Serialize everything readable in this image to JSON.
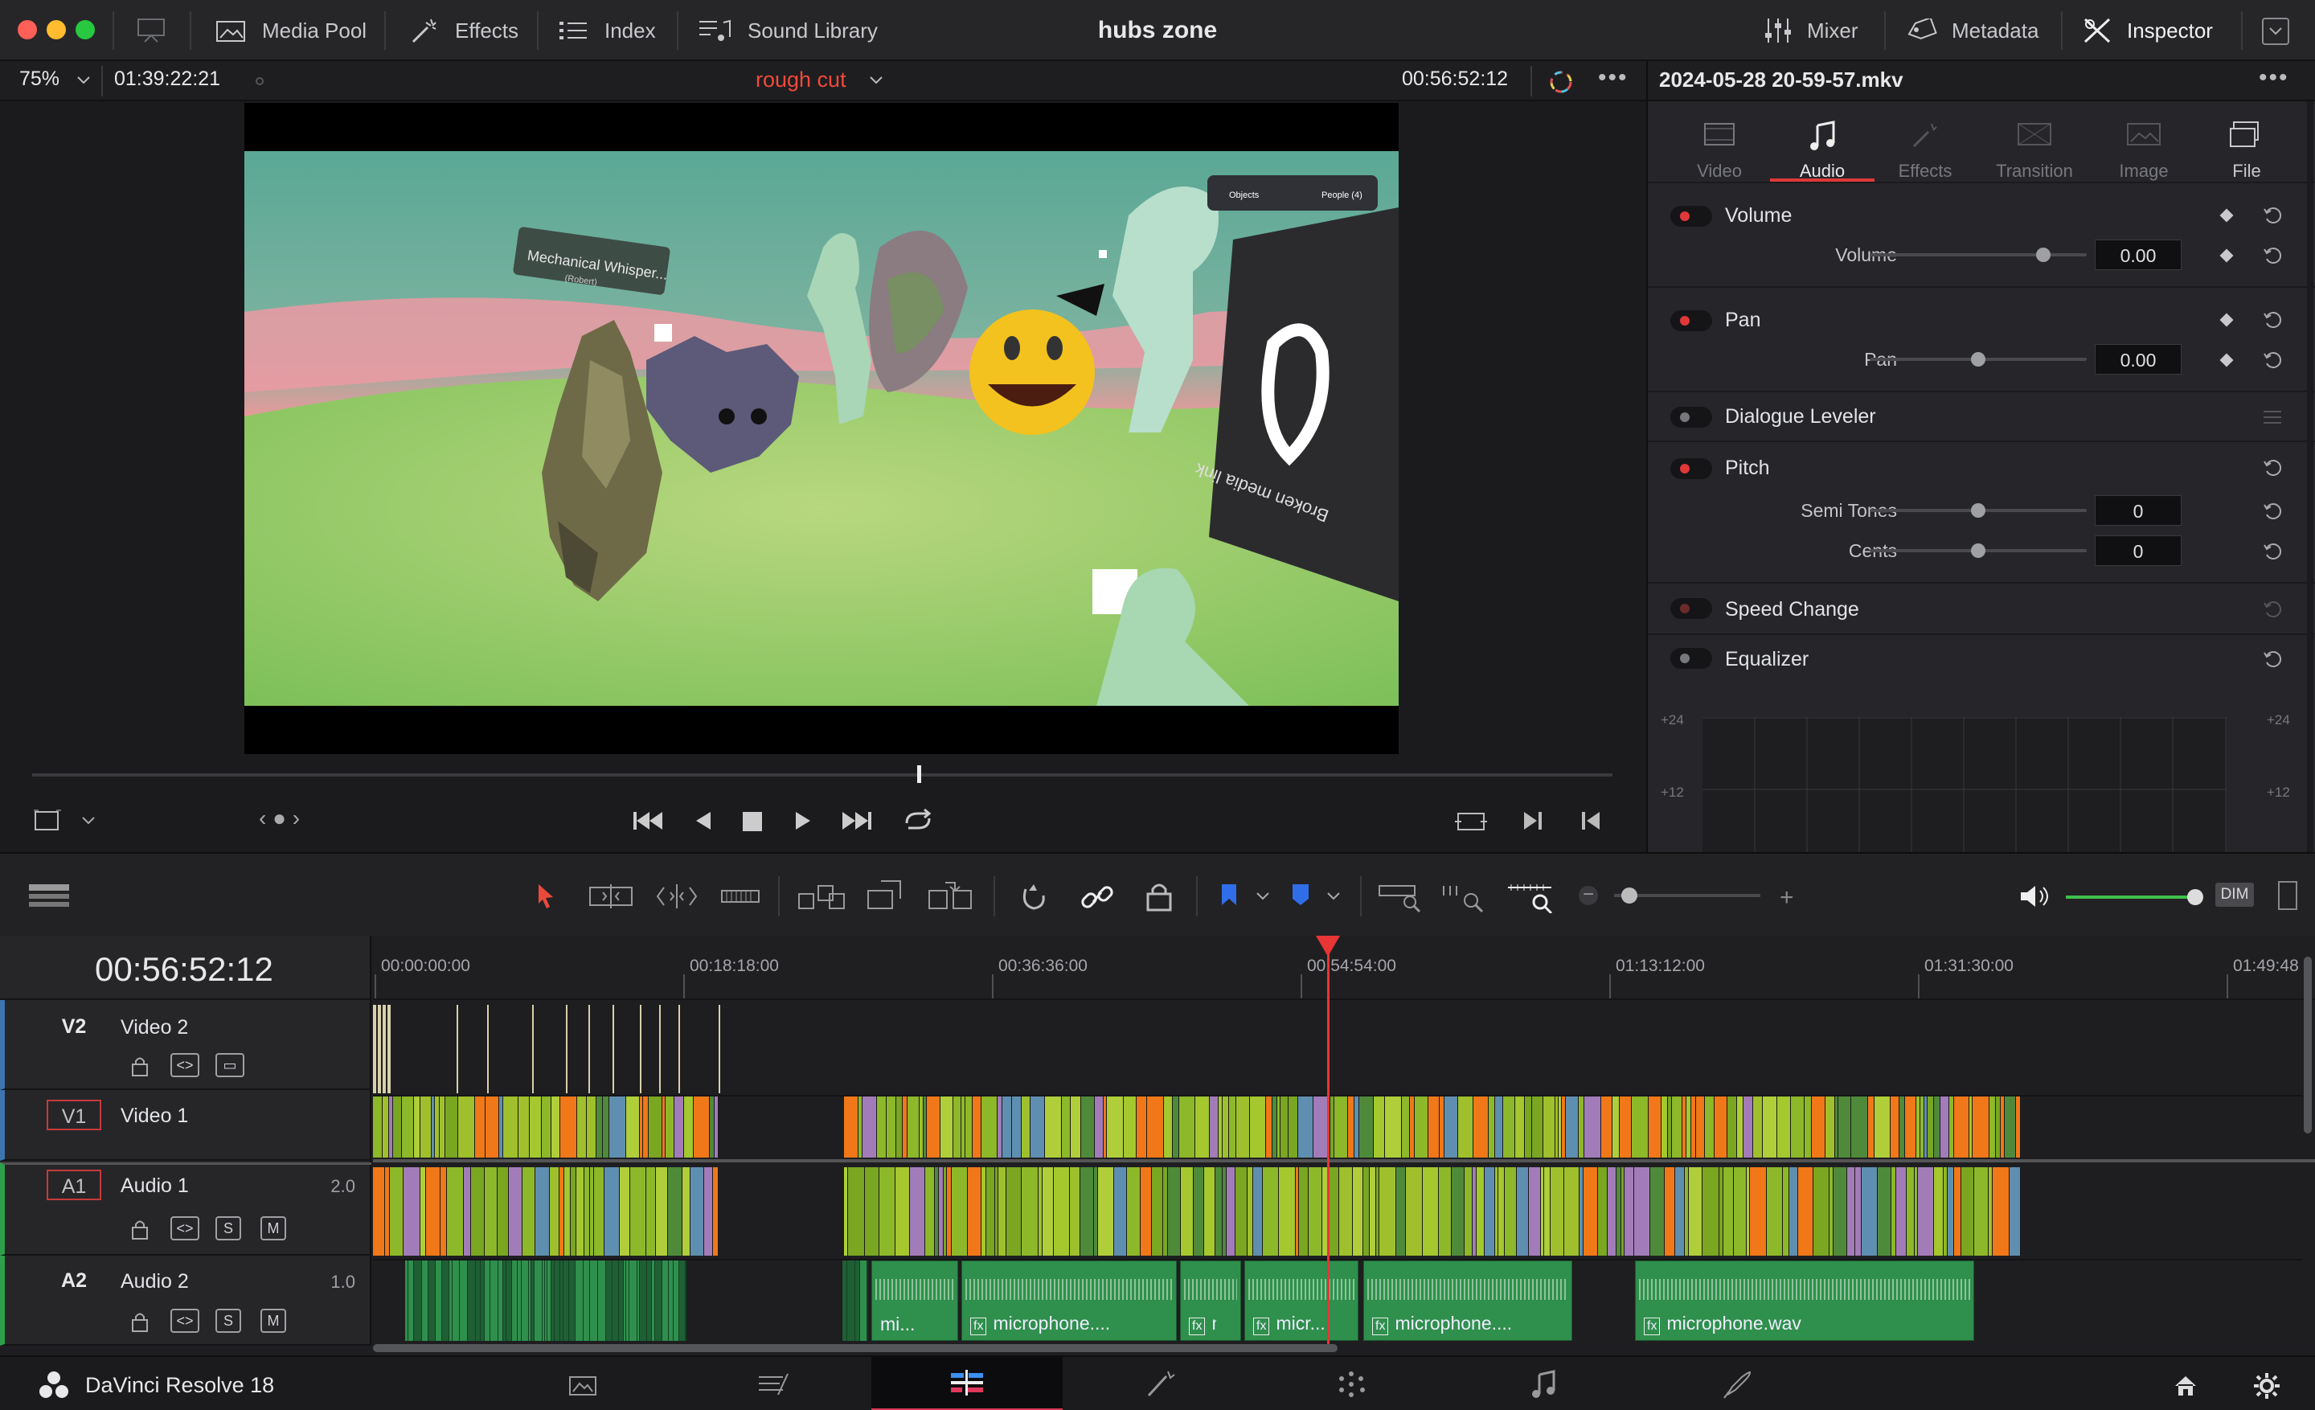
{
  "titlebar": {
    "project_title": "hubs zone",
    "left_buttons": [
      {
        "label": "Media Pool",
        "icon": "media-pool-icon"
      },
      {
        "label": "Effects",
        "icon": "effects-wand-icon"
      },
      {
        "label": "Index",
        "icon": "index-list-icon"
      },
      {
        "label": "Sound Library",
        "icon": "sound-library-icon"
      }
    ],
    "right_buttons": [
      {
        "label": "Mixer",
        "icon": "mixer-icon"
      },
      {
        "label": "Metadata",
        "icon": "metadata-tag-icon"
      },
      {
        "label": "Inspector",
        "icon": "inspector-icon"
      }
    ]
  },
  "viewer": {
    "zoom": "75%",
    "source_timecode": "01:39:22:21",
    "timeline_name": "rough cut",
    "current_timecode": "00:56:52:12",
    "scrub_progress": 0.56,
    "scene_labels": {
      "sign": "Mechanical Whisper...",
      "sign_sub": "(Robert)",
      "objects": "Objects",
      "people": "People (4)",
      "broken": "Broken media link"
    }
  },
  "inspector": {
    "clip_name": "2024-05-28 20-59-57.mkv",
    "tabs": [
      {
        "label": "Video",
        "active": false
      },
      {
        "label": "Audio",
        "active": true
      },
      {
        "label": "Effects",
        "active": false
      },
      {
        "label": "Transition",
        "active": false
      },
      {
        "label": "Image",
        "active": false
      },
      {
        "label": "File",
        "active": false
      }
    ],
    "sections": {
      "volume": {
        "title": "Volume",
        "param": "Volume",
        "value": "0.00",
        "level": 0.8
      },
      "pan": {
        "title": "Pan",
        "param": "Pan",
        "value": "0.00",
        "level": 0.5
      },
      "dialogue": {
        "title": "Dialogue Leveler"
      },
      "pitch": {
        "title": "Pitch",
        "semi_label": "Semi Tones",
        "semi_value": "0",
        "semi_level": 0.5,
        "cents_label": "Cents",
        "cents_value": "0",
        "cents_level": 0.5
      },
      "speed": {
        "title": "Speed Change"
      },
      "eq": {
        "title": "Equalizer",
        "db_top": "+24",
        "db_mid": "+12"
      }
    }
  },
  "timeline": {
    "timecode": "00:56:52:12",
    "ruler_labels": [
      "00:00:00:00",
      "00:18:18:00",
      "00:36:36:00",
      "00:54:54:00",
      "01:13:12:00",
      "01:31:30:00",
      "01:49:48"
    ],
    "dim_label": "DIM",
    "audio_level": 1.0,
    "zoom_level": 0.1,
    "playhead_fraction": 0.56,
    "tracks": [
      {
        "id": "V2",
        "name": "Video 2",
        "vol": ""
      },
      {
        "id": "V1",
        "name": "Video 1",
        "vol": ""
      },
      {
        "id": "A1",
        "name": "Audio 1",
        "vol": "2.0",
        "s": "S",
        "m": "M"
      },
      {
        "id": "A2",
        "name": "Audio 2",
        "vol": "1.0",
        "s": "S",
        "m": "M"
      }
    ],
    "a2_clips": [
      {
        "label": "mi..."
      },
      {
        "label": "microphone...."
      },
      {
        "label": "micr..."
      },
      {
        "label": "micr..."
      },
      {
        "label": "microphone...."
      },
      {
        "label": "microphone.wav"
      }
    ]
  },
  "bottombar": {
    "app_name": "DaVinci Resolve 18",
    "pages": [
      "media-page-icon",
      "cut-page-icon",
      "edit-page-icon",
      "fusion-page-icon",
      "color-page-icon",
      "fairlight-page-icon",
      "deliver-page-icon"
    ],
    "active_page": 2
  },
  "colors": {
    "accent_red": "#e03838",
    "clip_green": "#8db82a",
    "clip_orange": "#f07818",
    "audio_dark_green": "#2f8f4c",
    "playhead": "#e83535"
  }
}
